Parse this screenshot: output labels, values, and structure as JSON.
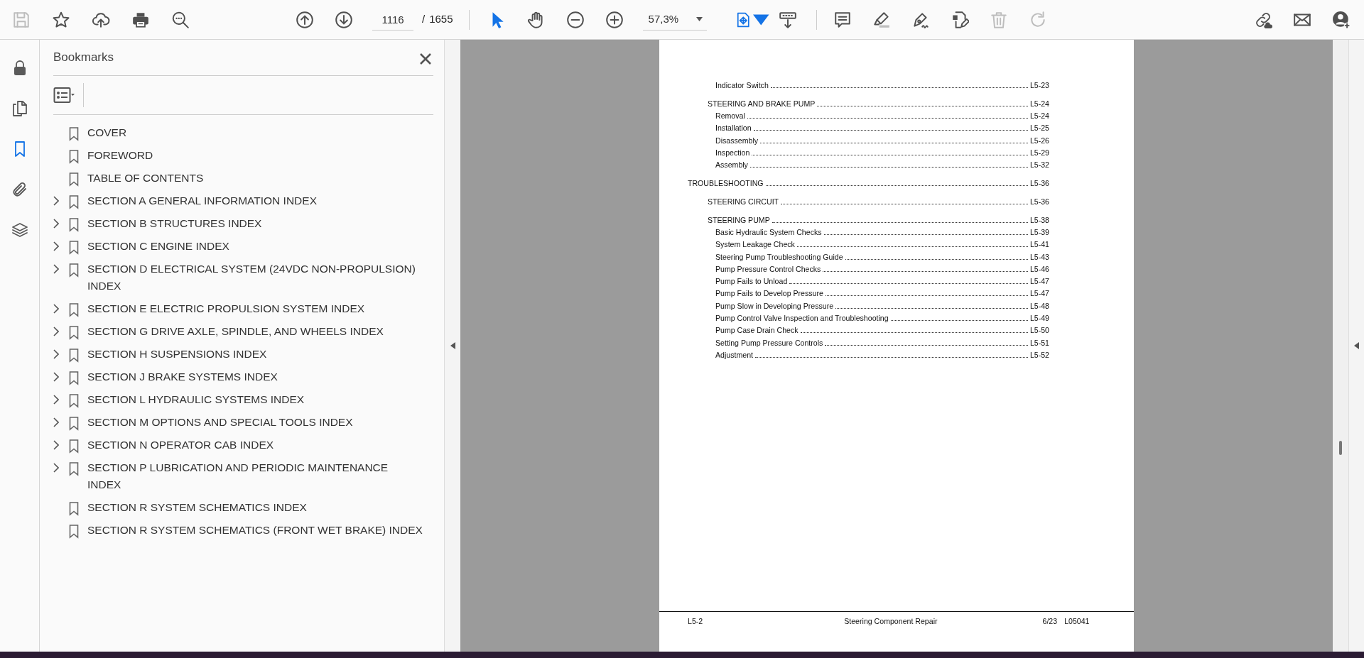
{
  "toolbar": {
    "file_tools": [
      {
        "kind": "save",
        "disabled": true
      },
      {
        "kind": "star",
        "disabled": false
      },
      {
        "kind": "upload",
        "disabled": false
      },
      {
        "kind": "print",
        "disabled": false
      },
      {
        "kind": "find",
        "disabled": false
      }
    ],
    "nav_tools": [
      {
        "kind": "up"
      },
      {
        "kind": "down"
      }
    ],
    "page_number": "1116",
    "page_separator": "/",
    "page_count": "1655",
    "view_tools": [
      {
        "kind": "pointer",
        "selected": true
      },
      {
        "kind": "hand",
        "selected": false
      },
      {
        "kind": "minus",
        "selected": false
      },
      {
        "kind": "plus",
        "selected": false
      }
    ],
    "zoom": "57,3%",
    "mode_tools": [
      {
        "kind": "fit",
        "selected": true,
        "has_menu": true
      },
      {
        "kind": "scroll",
        "selected": false
      }
    ],
    "edit_tools": [
      {
        "kind": "comment",
        "disabled": false
      },
      {
        "kind": "highlight",
        "disabled": false
      },
      {
        "kind": "sign",
        "disabled": false
      },
      {
        "kind": "edit",
        "disabled": false
      },
      {
        "kind": "trash",
        "disabled": true
      },
      {
        "kind": "redo",
        "disabled": true
      }
    ],
    "share_tools": [
      {
        "kind": "link"
      },
      {
        "kind": "mail"
      },
      {
        "kind": "user"
      }
    ]
  },
  "rail": [
    {
      "kind": "lock",
      "selected": false
    },
    {
      "kind": "pages",
      "selected": false
    },
    {
      "kind": "bookmark",
      "selected": true
    },
    {
      "kind": "clip",
      "selected": false
    },
    {
      "kind": "layers",
      "selected": false
    }
  ],
  "bookmarks": {
    "title": "Bookmarks",
    "items": [
      {
        "label": "COVER",
        "expandable": false
      },
      {
        "label": "FOREWORD",
        "expandable": false
      },
      {
        "label": "TABLE OF CONTENTS",
        "expandable": false
      },
      {
        "label": "SECTION A GENERAL INFORMATION INDEX",
        "expandable": true
      },
      {
        "label": "SECTION B STRUCTURES INDEX",
        "expandable": true
      },
      {
        "label": "SECTION C ENGINE INDEX",
        "expandable": true
      },
      {
        "label": "SECTION D ELECTRICAL SYSTEM (24VDC NON-PROPULSION) INDEX",
        "expandable": true
      },
      {
        "label": "SECTION E ELECTRIC PROPULSION SYSTEM INDEX",
        "expandable": true
      },
      {
        "label": "SECTION G DRIVE AXLE, SPINDLE, AND WHEELS INDEX",
        "expandable": true
      },
      {
        "label": "SECTION H SUSPENSIONS INDEX",
        "expandable": true
      },
      {
        "label": "SECTION J BRAKE SYSTEMS INDEX",
        "expandable": true
      },
      {
        "label": "SECTION L HYDRAULIC SYSTEMS INDEX",
        "expandable": true
      },
      {
        "label": "SECTION M OPTIONS AND SPECIAL TOOLS INDEX",
        "expandable": true
      },
      {
        "label": "SECTION N OPERATOR CAB INDEX",
        "expandable": true
      },
      {
        "label": "SECTION P LUBRICATION AND PERIODIC MAINTENANCE INDEX",
        "expandable": true
      },
      {
        "label": "SECTION R SYSTEM SCHEMATICS INDEX",
        "expandable": false
      },
      {
        "label": "SECTION R SYSTEM SCHEMATICS (FRONT WET BRAKE) INDEX",
        "expandable": false
      }
    ]
  },
  "document_page": {
    "toc": [
      {
        "children": [
          {
            "children": [
              {
                "title": "Indicator Switch",
                "page": "L5-23"
              }
            ]
          },
          {
            "title": "STEERING AND BRAKE PUMP",
            "page": "L5-24",
            "children": [
              {
                "title": "Removal",
                "page": "L5-24"
              },
              {
                "title": "Installation",
                "page": "L5-25"
              },
              {
                "title": "Disassembly",
                "page": "L5-26"
              },
              {
                "title": "Inspection",
                "page": "L5-29"
              },
              {
                "title": "Assembly",
                "page": "L5-32"
              }
            ]
          }
        ]
      },
      {
        "title": "TROUBLESHOOTING",
        "page": "L5-36",
        "children": [
          {
            "title": "STEERING CIRCUIT",
            "page": "L5-36"
          },
          {
            "title": "STEERING PUMP",
            "page": "L5-38",
            "children": [
              {
                "title": "Basic Hydraulic System Checks",
                "page": "L5-39"
              },
              {
                "title": "System Leakage Check",
                "page": "L5-41"
              },
              {
                "title": "Steering Pump Troubleshooting Guide",
                "page": "L5-43"
              },
              {
                "title": "Pump Pressure Control Checks",
                "page": "L5-46"
              },
              {
                "title": "Pump Fails to Unload",
                "page": "L5-47"
              },
              {
                "title": "Pump Fails to Develop Pressure",
                "page": "L5-47"
              },
              {
                "title": "Pump Slow in Developing Pressure",
                "page": "L5-48"
              },
              {
                "title": "Pump Control Valve Inspection and Troubleshooting",
                "page": "L5-49"
              },
              {
                "title": "Pump Case Drain Check",
                "page": "L5-50"
              },
              {
                "title": "Setting Pump Pressure Controls",
                "page": "L5-51"
              },
              {
                "title": "Adjustment",
                "page": "L5-52"
              }
            ]
          }
        ]
      }
    ],
    "footer": {
      "page": "L5-2",
      "title": "Steering Component Repair",
      "date": "6/23",
      "code": "L05041"
    }
  }
}
